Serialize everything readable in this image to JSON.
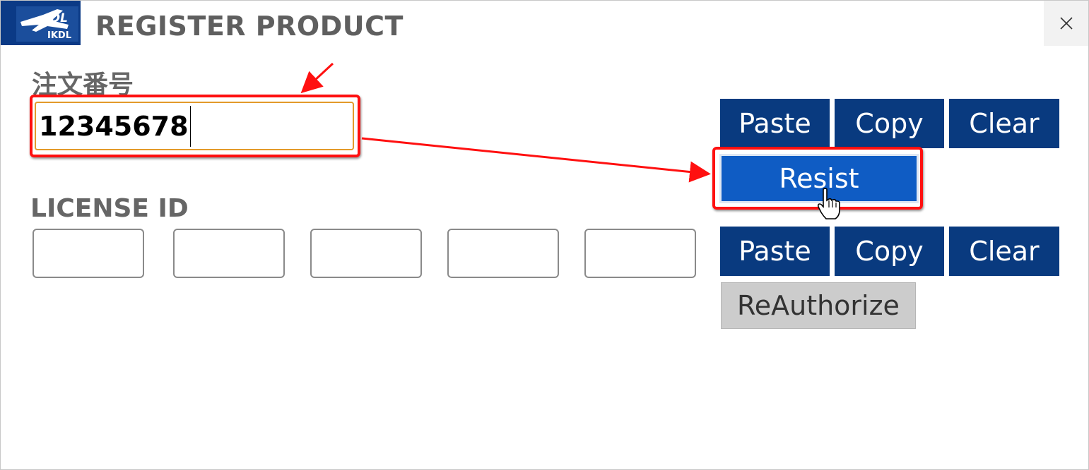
{
  "window": {
    "title": "REGISTER PRODUCT",
    "logo_text_top": "DL",
    "logo_text_bottom": "IKDL"
  },
  "order": {
    "label": "注文番号",
    "value": "12345678"
  },
  "license": {
    "label": "LICENSE ID",
    "fields": [
      "",
      "",
      "",
      "",
      ""
    ]
  },
  "buttons": {
    "paste": "Paste",
    "copy": "Copy",
    "clear": "Clear",
    "resist": "Resist",
    "paste2": "Paste",
    "copy2": "Copy",
    "clear2": "Clear",
    "reauthorize": "ReAuthorize"
  },
  "icons": {
    "close": "close-icon",
    "cursor": "hand-pointer-icon",
    "logo": "airplane-logo-icon"
  },
  "colors": {
    "button_blue": "#093a7f",
    "resist_blue": "#0f5cc4",
    "annotation_red": "#ff1010",
    "input_focus": "#e39a2a",
    "label_gray": "#666666"
  }
}
